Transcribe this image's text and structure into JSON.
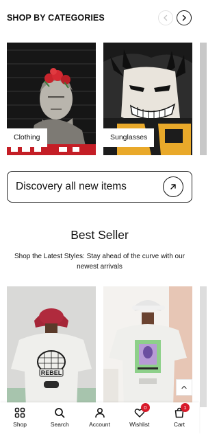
{
  "categories": {
    "title": "SHOP BY CATEGORIES",
    "items": [
      {
        "label": "Clothing"
      },
      {
        "label": "Sunglasses"
      },
      {
        "label": ""
      }
    ]
  },
  "discover": {
    "label": "Discovery all new items"
  },
  "best_seller": {
    "title": "Best Seller",
    "subtitle": "Shop the Latest Styles: Stay ahead of the curve with our newest arrivals",
    "shirt_print_text": "REBEL"
  },
  "tabbar": {
    "items": [
      {
        "label": "Shop",
        "icon": "grid-icon"
      },
      {
        "label": "Search",
        "icon": "search-icon"
      },
      {
        "label": "Account",
        "icon": "user-icon"
      },
      {
        "label": "Wishlist",
        "icon": "heart-icon",
        "badge": "0"
      },
      {
        "label": "Cart",
        "icon": "cart-icon",
        "badge": "1"
      }
    ]
  },
  "colors": {
    "badge": "#d81a2a",
    "text": "#111111",
    "border": "#222222"
  }
}
